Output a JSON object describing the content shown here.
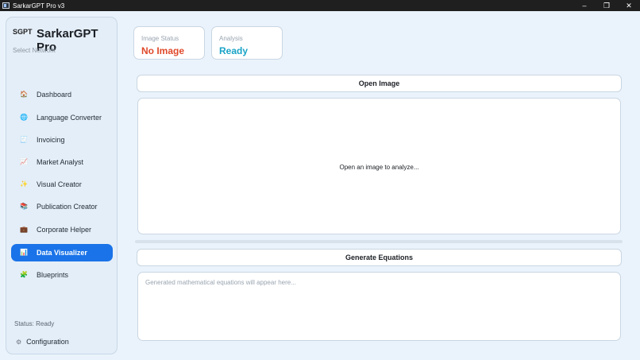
{
  "window": {
    "title": "SarkarGPT Pro v3",
    "controls": {
      "minimize": "–",
      "maximize": "❐",
      "close": "✕"
    }
  },
  "sidebar": {
    "brand_small": "SGPT",
    "brand": "SarkarGPT Pro",
    "select_network": "Select Network",
    "items": [
      {
        "label": "Dashboard",
        "icon": "house-icon",
        "glyph": "🏠",
        "color": "#c0563a"
      },
      {
        "label": "Language Converter",
        "icon": "globe-icon",
        "glyph": "🌐",
        "color": "#2a8fb8"
      },
      {
        "label": "Invoicing",
        "icon": "receipt-icon",
        "glyph": "🧾",
        "color": "#9a8cc7"
      },
      {
        "label": "Market Analyst",
        "icon": "chart-icon",
        "glyph": "📈",
        "color": "#2e9a52"
      },
      {
        "label": "Visual Creator",
        "icon": "sparkle-icon",
        "glyph": "✨",
        "color": "#e8a317"
      },
      {
        "label": "Publication Creator",
        "icon": "book-icon",
        "glyph": "📚",
        "color": "#a7b3c0"
      },
      {
        "label": "Corporate Helper",
        "icon": "briefcase-icon",
        "glyph": "💼",
        "color": "#6b4a3a"
      },
      {
        "label": "Data Visualizer",
        "icon": "bar-chart-icon",
        "glyph": "📊",
        "color": "#ffffff"
      },
      {
        "label": "Blueprints",
        "icon": "puzzle-icon",
        "glyph": "🧩",
        "color": "#4caf50"
      }
    ],
    "active_index": 7,
    "status": "Status: Ready",
    "config_label": "Configuration",
    "config_icon": "gear-icon"
  },
  "status_cards": {
    "image": {
      "label": "Image Status",
      "value": "No Image",
      "color": "#e0492a"
    },
    "analysis": {
      "label": "Analysis",
      "value": "Ready",
      "color": "#19a3c7"
    }
  },
  "main": {
    "open_image_label": "Open Image",
    "image_placeholder": "Open an image to analyze...",
    "generate_label": "Generate Equations",
    "equations_placeholder": "Generated mathematical equations will appear here..."
  }
}
